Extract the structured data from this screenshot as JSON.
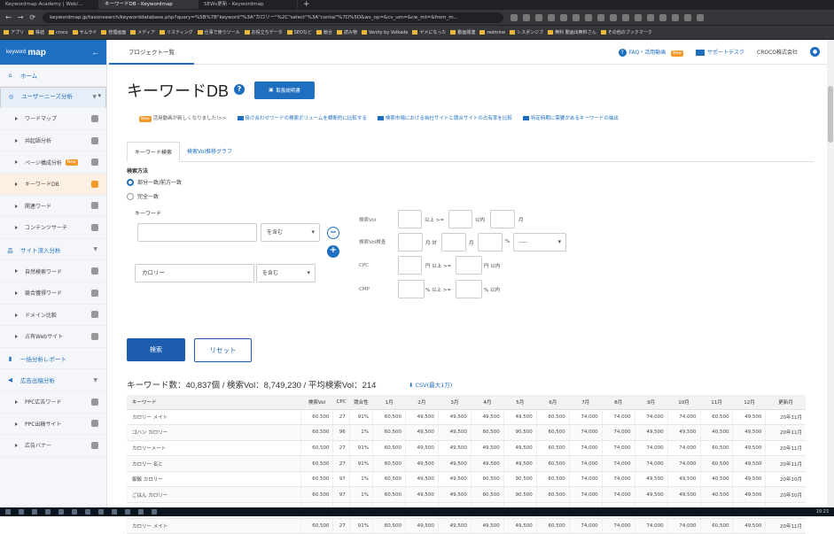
{
  "browser": {
    "tabs": [
      "Keywordmap Academy | Web/…",
      "キーワードDB - Keywordmap",
      "SEWs更新 - Keywordmap"
    ],
    "url": "keywordmap.jp/taxonsearch/keyworddatabase.php?query=%5B%7B\"keyword\"%3A\"カロリー\"%2C\"select\"%3A\"contai\"%7D%5D&ws_op=&cv_um=&cw_mt=&from_m...",
    "bookmarks": [
      "アプリ",
      "株値",
      "croco",
      "サムライ",
      "管理画面",
      "メディア",
      "リスティング",
      "仕事で使うツール",
      "お役立ちデータ",
      "SEOなど",
      "競合",
      "読み物",
      "Venity by Volkade",
      "ヤメになった",
      "動画閲連",
      "redmine",
      "シスポンジブ",
      "無料 動画出無料さん",
      "その他のブックマーク"
    ]
  },
  "sidebar": {
    "logo_small": "keyword",
    "logo": "map",
    "back": "←",
    "items": [
      {
        "label": "ホーム",
        "type": "top"
      },
      {
        "label": "ユーザーニーズ分析",
        "type": "top"
      },
      {
        "label": "ワードマップ",
        "type": "sub"
      },
      {
        "label": "共起語分析",
        "type": "sub"
      },
      {
        "label": "ページ構成分析",
        "type": "sub",
        "tag": "New"
      },
      {
        "label": "キーワードDB",
        "type": "sub"
      },
      {
        "label": "関連ワード",
        "type": "sub"
      },
      {
        "label": "コンテンツサーチ",
        "type": "sub"
      },
      {
        "label": "サイト流入分析",
        "type": "top"
      },
      {
        "label": "自然検索ワード",
        "type": "sub"
      },
      {
        "label": "競合獲得ワード",
        "type": "sub"
      },
      {
        "label": "ドメイン比較",
        "type": "sub"
      },
      {
        "label": "占有Webサイト",
        "type": "sub"
      },
      {
        "label": "一括分析レポート",
        "type": "top"
      },
      {
        "label": "広告出稿分析",
        "type": "top"
      },
      {
        "label": "PPC広告ワード",
        "type": "sub"
      },
      {
        "label": "PPC出稿サイト",
        "type": "sub"
      },
      {
        "label": "広告バナー",
        "type": "sub"
      }
    ]
  },
  "topbar": {
    "project": "プロジェクト一覧",
    "faq": "FAQ・活用動画",
    "faq_tag": "New",
    "support": "サポートデスク",
    "company": "CROCO株式会社"
  },
  "page": {
    "title": "キーワードDB",
    "guide_button": "取扱説明書",
    "notice_label": "New",
    "notice_text": "活用動画が新しくなりました!>>",
    "notices": [
      "掛け合わせワードの検索ボリュームを横断的に比較する",
      "検索市場における自社サイトと競合サイトの占有率を比較",
      "特定時期に需要があるキーワードの抽出"
    ]
  },
  "tabs": [
    "キーワード検索",
    "検索Vol推移グラフ"
  ],
  "form": {
    "method_label": "検索方法",
    "radio1": "部分一致/前方一致",
    "radio2": "完全一致",
    "keyword_label": "キーワード",
    "kw1_value": "",
    "kw1_op": "を含む",
    "kw2_value": "カロリー",
    "kw2_op": "を含む",
    "minus": "−",
    "plus": "+",
    "vol_label": "検索Vol",
    "vol_ge": "以上 >=",
    "vol_le": "以内",
    "vol_unit": "月",
    "rate_label": "検索Vol検査",
    "rate_m1": "月 対",
    "rate_m2": "月",
    "rate_pct": "%",
    "rate_select": "----",
    "cpc_label": "CPC",
    "cpc_ge": "円 以上 >=",
    "cpc_le": "円 以内",
    "cmp_label": "CMP",
    "cmp_ge": "% 以上 >=",
    "cmp_le": "% 以内",
    "search_button": "検索",
    "reset_button": "リセット"
  },
  "results": {
    "summary": "キーワード数：40,837個 / 検索Vol：8,749,230 / 平均検索Vol：214",
    "csv": "CSV(最大1万)",
    "headers": [
      "キーワード",
      "検索Vol",
      "CPC",
      "競合性",
      "1月",
      "2月",
      "3月",
      "4月",
      "5月",
      "6月",
      "7月",
      "8月",
      "9月",
      "10月",
      "11月",
      "12月",
      "更新月"
    ],
    "rows": [
      [
        "カロリー メイト",
        "60,500",
        "27",
        "91%",
        "60,500",
        "49,500",
        "49,500",
        "49,500",
        "49,500",
        "60,500",
        "74,000",
        "74,000",
        "74,000",
        "74,000",
        "60,500",
        "49,500",
        "20年11月"
      ],
      [
        "ゴハン カロリー",
        "60,500",
        "96",
        "1%",
        "60,500",
        "49,500",
        "49,500",
        "60,500",
        "90,500",
        "60,500",
        "74,000",
        "74,000",
        "49,500",
        "49,500",
        "40,500",
        "49,500",
        "20年11月"
      ],
      [
        "カロリーメート",
        "60,500",
        "27",
        "91%",
        "60,500",
        "49,500",
        "49,500",
        "49,500",
        "49,500",
        "60,500",
        "74,000",
        "74,000",
        "74,000",
        "74,000",
        "60,500",
        "49,500",
        "20年11月"
      ],
      [
        "カロリー 名と",
        "60,500",
        "27",
        "91%",
        "60,500",
        "49,500",
        "49,500",
        "49,500",
        "49,500",
        "60,500",
        "74,000",
        "74,000",
        "74,000",
        "74,000",
        "60,500",
        "49,500",
        "20年11月"
      ],
      [
        "御飯 カロリー",
        "60,500",
        "97",
        "1%",
        "60,500",
        "49,500",
        "49,500",
        "60,500",
        "90,500",
        "60,500",
        "74,000",
        "74,000",
        "49,500",
        "49,500",
        "40,500",
        "49,500",
        "20年10月"
      ],
      [
        "ごはん カロリー",
        "60,500",
        "97",
        "1%",
        "60,500",
        "49,500",
        "49,500",
        "60,500",
        "90,500",
        "60,500",
        "74,000",
        "74,000",
        "49,500",
        "49,500",
        "40,500",
        "49,500",
        "20年10月"
      ],
      [
        "ご飯 カロリー",
        "60,500",
        "97",
        "1%",
        "60,500",
        "49,500",
        "49,500",
        "60,500",
        "90,500",
        "60,500",
        "74,000",
        "74,000",
        "49,500",
        "49,500",
        "40,500",
        "49,500",
        "20年10月"
      ],
      [
        "カロリー メイト",
        "60,500",
        "27",
        "91%",
        "60,500",
        "49,500",
        "49,500",
        "49,500",
        "49,500",
        "60,500",
        "74,000",
        "74,000",
        "74,000",
        "74,000",
        "60,500",
        "49,500",
        "20年11月"
      ]
    ]
  },
  "taskbar": {
    "clock": "19:23"
  }
}
